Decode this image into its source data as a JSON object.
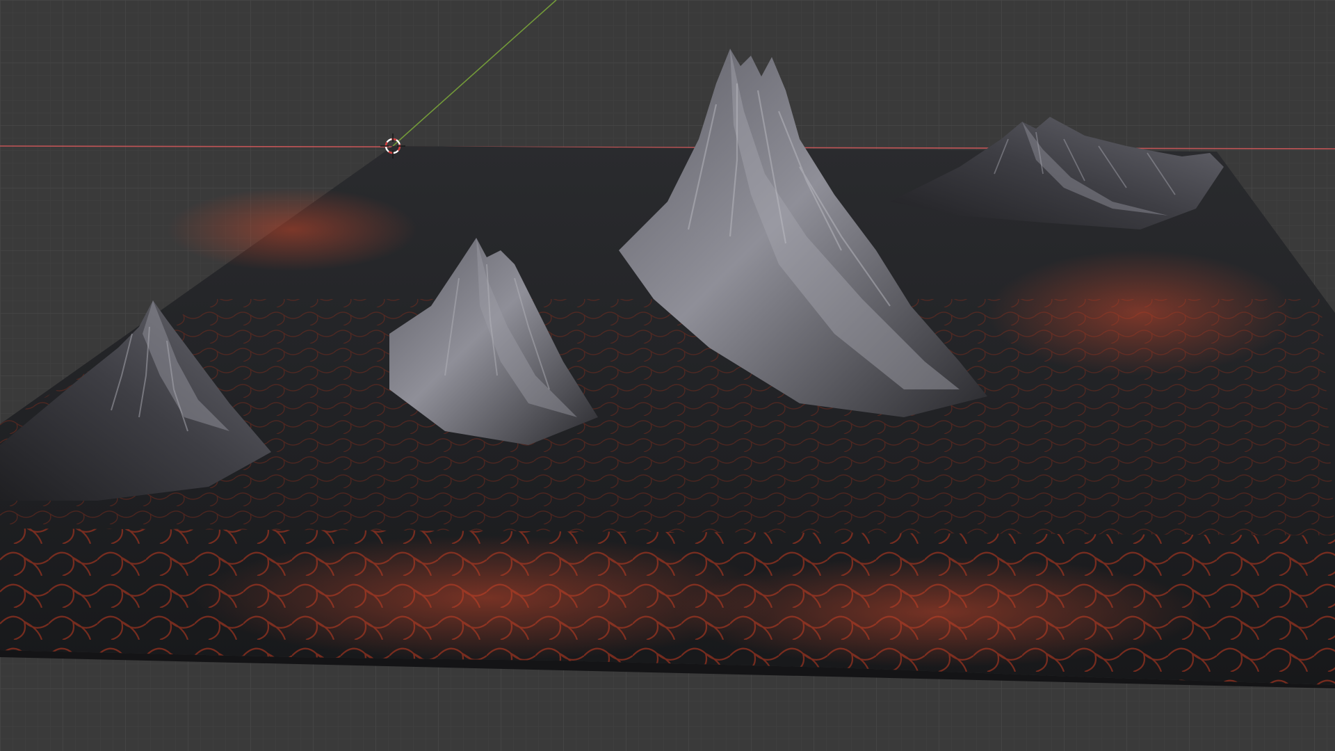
{
  "viewport": {
    "kind": "3d-viewport",
    "background_color": "#3a3a3a",
    "grid_color": "#474747",
    "grid_minor_color": "#414141",
    "x_axis_color": "#d0585a",
    "y_axis_color": "#7aa53a",
    "terrain_base_color": "#1c1c1e",
    "lava_color": "#b23a22",
    "rock_highlight_color": "#9a9aa2"
  },
  "scene": {
    "object": "volcanic-terrain-mesh",
    "peaks_visible": 4,
    "cursor_icon": "3d-cursor-icon"
  }
}
